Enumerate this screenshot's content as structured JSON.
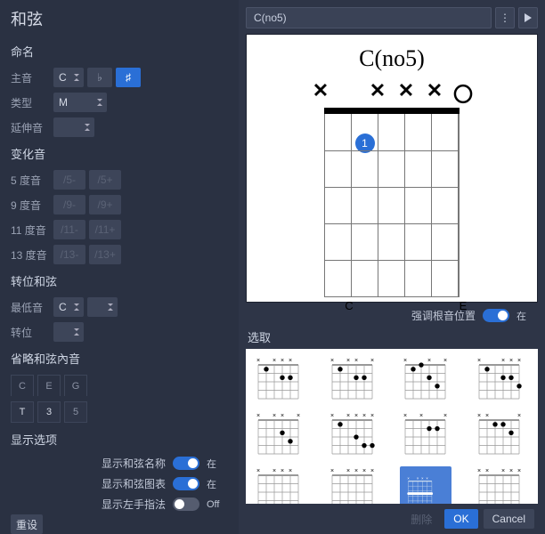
{
  "panel_title": "和弦",
  "sections": {
    "naming": "命名",
    "altered": "变化音",
    "slash": "转位和弦",
    "omit": "省略和弦內音",
    "display": "显示选项",
    "select": "选取"
  },
  "labels": {
    "root": "主音",
    "type": "类型",
    "ext": "延伸音",
    "alt5": "5 度音",
    "alt9": "9 度音",
    "alt11": "11 度音",
    "alt13": "13 度音",
    "bass": "最低音",
    "inversion": "转位",
    "show_name": "显示和弦名称",
    "show_diagram": "显示和弦图表",
    "show_finger": "显示左手指法",
    "emphasize": "强调根音位置"
  },
  "values": {
    "root": "C",
    "flat": "♭",
    "sharp": "♯",
    "type": "M",
    "ext": "",
    "alt5m": "/5-",
    "alt5p": "/5+",
    "alt9m": "/9-",
    "alt9p": "/9+",
    "alt11m": "/11-",
    "alt11p": "/11+",
    "alt13m": "/13-",
    "alt13p": "/13+",
    "bass": "C",
    "inversion": "",
    "tones": [
      "C",
      "E",
      "G"
    ],
    "tone_vals": [
      "T",
      "3",
      "5"
    ],
    "tone_enabled": [
      true,
      true,
      false
    ]
  },
  "toggles": {
    "show_name": true,
    "show_diagram": true,
    "show_finger": false,
    "emphasize": true
  },
  "toggle_states": {
    "on": "在",
    "off": "Off"
  },
  "chord_name": "C(no5)",
  "chord_diagram": {
    "title": "C(no5)",
    "mutes": [
      "✕",
      "",
      "✕",
      "✕",
      "✕",
      "〇"
    ],
    "note_labels": [
      "",
      "C",
      "",
      "",
      "",
      "E"
    ],
    "fingers": [
      {
        "string": 1,
        "fret": 1,
        "num": "1"
      }
    ]
  },
  "voicings": [
    {
      "mutes": [
        1,
        0,
        1,
        1,
        1,
        0
      ],
      "dots": [
        [
          1,
          1
        ],
        [
          3,
          2
        ],
        [
          4,
          2
        ]
      ],
      "bar": null,
      "sel": false
    },
    {
      "mutes": [
        1,
        0,
        1,
        1,
        0,
        1
      ],
      "dots": [
        [
          1,
          1
        ],
        [
          3,
          2
        ],
        [
          4,
          2
        ]
      ],
      "bar": null,
      "sel": false
    },
    {
      "mutes": [
        1,
        0,
        0,
        1,
        0,
        1
      ],
      "dots": [
        [
          1,
          1
        ],
        [
          2,
          0.5
        ],
        [
          3,
          2
        ],
        [
          4,
          3
        ]
      ],
      "bar": null,
      "sel": false
    },
    {
      "mutes": [
        1,
        0,
        0,
        1,
        1,
        1
      ],
      "dots": [
        [
          1,
          1
        ],
        [
          3,
          2
        ],
        [
          4,
          2
        ],
        [
          5,
          3
        ]
      ],
      "bar": null,
      "sel": false
    },
    {
      "mutes": [
        1,
        0,
        1,
        1,
        0,
        1
      ],
      "dots": [
        [
          3,
          2
        ],
        [
          4,
          3
        ]
      ],
      "bar": null,
      "sel": false
    },
    {
      "mutes": [
        1,
        0,
        1,
        1,
        1,
        1
      ],
      "dots": [
        [
          1,
          1
        ],
        [
          3,
          2.5
        ],
        [
          4,
          3.5
        ],
        [
          5,
          3.5
        ]
      ],
      "bar": null,
      "sel": false
    },
    {
      "mutes": [
        1,
        0,
        1,
        0,
        0,
        1
      ],
      "dots": [
        [
          3,
          1.5
        ],
        [
          4,
          1.5
        ]
      ],
      "bar": null,
      "sel": false
    },
    {
      "mutes": [
        1,
        1,
        0,
        0,
        0,
        1
      ],
      "dots": [
        [
          2,
          1
        ],
        [
          3,
          1
        ],
        [
          4,
          2
        ]
      ],
      "bar": null,
      "sel": false
    },
    {
      "mutes": [
        1,
        0,
        1,
        1,
        1,
        0
      ],
      "dots": [],
      "bar": null,
      "sel": false,
      "cut": true
    },
    {
      "mutes": [
        1,
        0,
        1,
        1,
        1,
        1
      ],
      "dots": [],
      "bar": null,
      "sel": false,
      "cut": true
    },
    {
      "mutes": [
        1,
        0,
        1,
        1,
        1,
        0
      ],
      "dots": [],
      "bar": 3,
      "sel": true,
      "cut": true
    },
    {
      "mutes": [
        1,
        1,
        0,
        1,
        1,
        1
      ],
      "dots": [],
      "bar": null,
      "sel": false,
      "cut": true
    }
  ],
  "buttons": {
    "reset": "重设",
    "delete": "删除",
    "ok": "OK",
    "cancel": "Cancel"
  }
}
